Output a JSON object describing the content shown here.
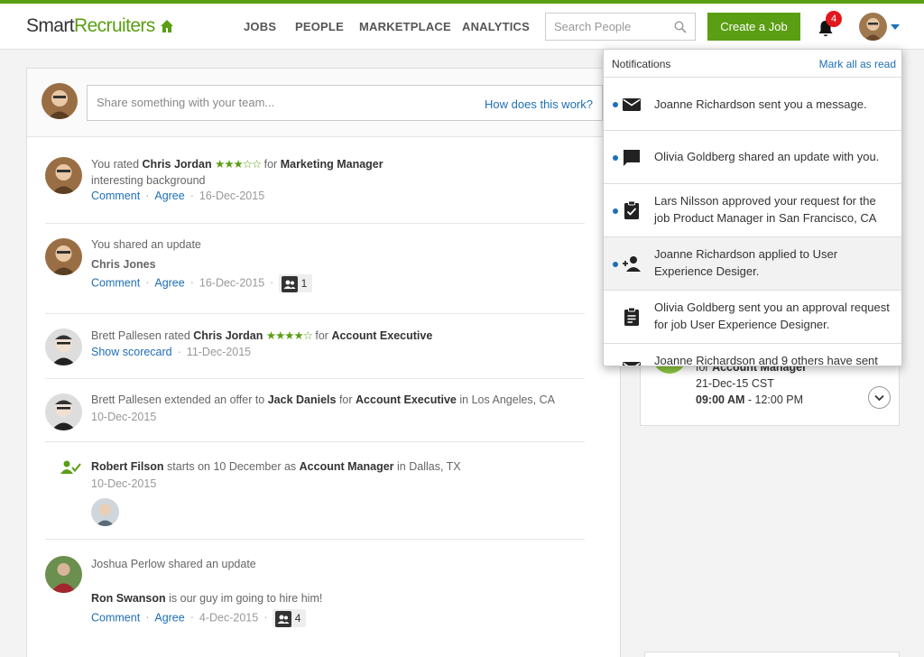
{
  "header": {
    "logo_smart": "Smart",
    "logo_recruiters": "Recruiters",
    "nav": [
      "JOBS",
      "PEOPLE",
      "MARKETPLACE",
      "ANALYTICS"
    ],
    "search_placeholder": "Search People",
    "create_job": "Create a Job",
    "notification_count": "4"
  },
  "share": {
    "placeholder": "Share something with your team...",
    "help_link": "How does this work?"
  },
  "feed": {
    "item1": {
      "prefix": "You rated ",
      "person": "Chris Jordan",
      "stars": "★★★☆☆",
      "for": " for ",
      "role": "Marketing Manager",
      "note": "interesting background",
      "comment": "Comment",
      "agree": "Agree",
      "date": "16-Dec-2015"
    },
    "item2": {
      "line": "You shared an update",
      "title": "Chris Jones",
      "comment": "Comment",
      "agree": "Agree",
      "date": "16-Dec-2015",
      "count": "1"
    },
    "item3": {
      "who": "Brett Pallesen rated ",
      "person": "Chris Jordan",
      "stars": "★★★★☆",
      "for": " for ",
      "role": "Account Executive",
      "link": "Show scorecard",
      "date": "11-Dec-2015"
    },
    "item4": {
      "who": "Brett Pallesen extended an offer to ",
      "person": "Jack Daniels",
      "for": " for ",
      "role": "Account Executive",
      "in": " in ",
      "place": "Los Angeles, CA",
      "date": "10-Dec-2015"
    },
    "item5": {
      "person": "Robert Filson",
      "starts": " starts on 10 December as ",
      "role": "Account Manager",
      "in": " in ",
      "place": "Dallas, TX",
      "date": "10-Dec-2015"
    },
    "item6": {
      "line": "Joshua Perlow shared an update",
      "person": "Ron Swanson",
      "msg": " is our guy im going to hire him!",
      "comment": "Comment",
      "agree": "Agree",
      "date": "4-Dec-2015",
      "count": "4"
    }
  },
  "event_card": {
    "role_prefix": "for ",
    "role": "Account Manager",
    "date": "21-Dec-15 CST",
    "time_start": "09:00 AM",
    "time_end": " - 12:00 PM"
  },
  "notifications": {
    "title": "Notifications",
    "mark_all": "Mark all as read",
    "items": [
      {
        "text": "Joanne Richardson sent you a message.",
        "icon": "mail-icon"
      },
      {
        "text": "Olivia Goldberg shared an update with you.",
        "icon": "chat-icon"
      },
      {
        "text": "Lars Nilsson approved your request for the job Product Manager in San Francisco, CA",
        "icon": "clipboard-check-icon"
      },
      {
        "text": "Joanne Richardson applied to User Experience Desiger.",
        "icon": "person-add-icon"
      },
      {
        "text": "Olivia Goldberg sent you an approval request for job User Experience Designer.",
        "icon": "clipboard-icon"
      },
      {
        "text": "Joanne Richardson and 9 others have sent",
        "icon": "mail-icon"
      }
    ]
  },
  "colors": {
    "brand_green": "#5a9e13",
    "link_blue": "#1f6fb5",
    "badge_red": "#e3161b"
  }
}
